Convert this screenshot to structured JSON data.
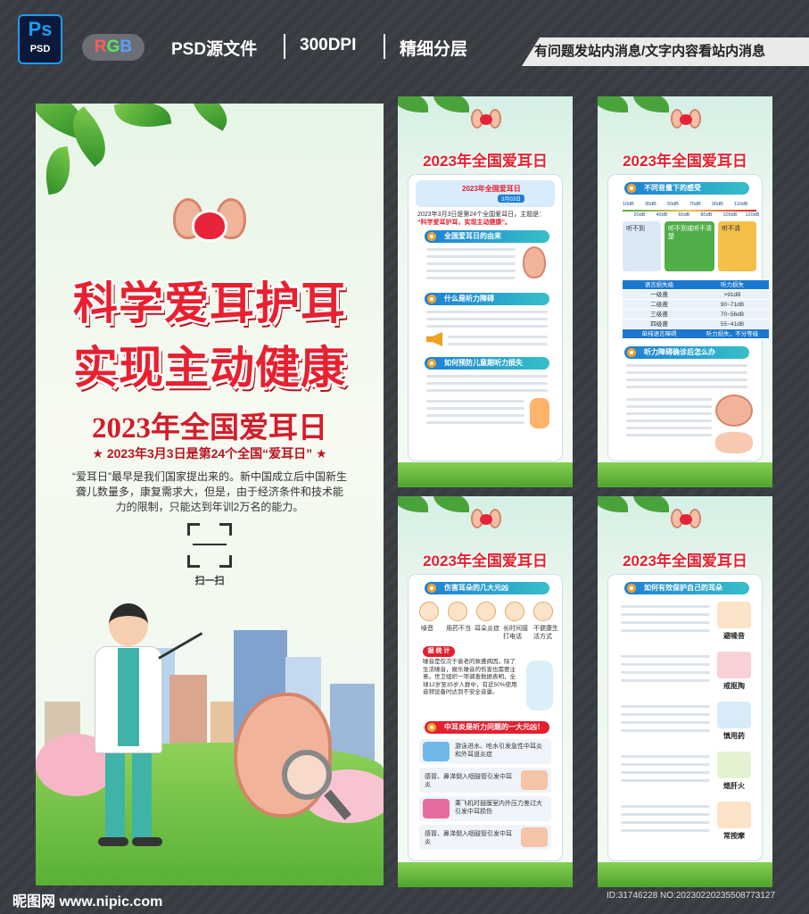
{
  "header": {
    "ps_logo": "Ps",
    "ps_sub": "PSD",
    "rgb_badge": [
      "R",
      "G",
      "B"
    ],
    "items": [
      "PSD源文件",
      "300DPI",
      "精细分层"
    ],
    "notice": "有问题发站内消息/文字内容看站内消息"
  },
  "main_poster": {
    "title_line1": "科学爱耳护耳",
    "title_line2": "实现主动健康",
    "subtitle": "2023年全国爱耳日",
    "tagline": "★ 2023年3月3日是第24个全国“爱耳日” ★",
    "body": "“爱耳日”最早是我们国家提出来的。新中国成立后中国新生聋儿数量多，康复需求大，但是，由于经济条件和技术能力的限制，只能达到年训2万名的能力。",
    "scan_label": "扫一扫"
  },
  "panels": [
    {
      "title": "2023年全国爱耳日",
      "banner": "2023年全国爱耳日",
      "banner_date": "3月03日",
      "intro": "2023年3月3日是第24个全国爱耳日，主题是：",
      "theme": "“科学爱耳护耳，实现主动健康”。",
      "sections": [
        "全国爱耳日的由来",
        "什么是听力障碍",
        "如何预防儿童期听力损失"
      ]
    },
    {
      "title": "2023年全国爱耳日",
      "sections": [
        "不同音量下的感受",
        "听力障碍确诊后怎么办"
      ],
      "db_scale": [
        "10dB",
        "20dB",
        "30dB",
        "40dB",
        "50dB",
        "60dB",
        "70dB",
        "80dB",
        "90dB",
        "100dB",
        "110dB",
        "120dB"
      ],
      "hear_labels": [
        "听不到",
        "听不到或听不清楚",
        "听不清"
      ],
      "table_header": [
        "语言损失级",
        "听力损失"
      ],
      "table_rows": [
        [
          "一级聋",
          ">91dB"
        ],
        [
          "二级聋",
          "90~71dB"
        ],
        [
          "三级聋",
          "70~56dB"
        ],
        [
          "四级聋",
          "55~41dB"
        ],
        [
          "单纯语言障碍",
          "听力损失，不分等级"
        ]
      ]
    },
    {
      "title": "2023年全国爱耳日",
      "sections": [
        "伤害耳朵的几大元凶",
        "中耳炎是听力问题的一大元凶！"
      ],
      "causes": [
        "噪音",
        "用药不当",
        "耳朵炎症",
        "长时间接打电话",
        "不健康生活方式"
      ],
      "stat_label": "据 统 计",
      "stat_text": "噪音是仅次于衰老的致聋病因。除了生活噪音，娱乐噪音的伤害也需要注意。世卫组织一项调查数据表明，全球12岁至35岁人群中，有近50%使用音频设备时达到不安全音量。",
      "otitis": [
        "游泳进水、呛水引发急性中耳炎和外耳道炎症",
        "感冒、鼻涕倒入咽鼓管引发中耳炎",
        "乘飞机时鼓膜室内外压力差过大引发中耳损伤",
        "感冒、鼻涕倒入咽鼓管引发中耳炎"
      ]
    },
    {
      "title": "2023年全国爱耳日",
      "sections": [
        "如何有效保护自己的耳朵"
      ],
      "tips": [
        "避噪音",
        "戒抠掏",
        "慎用药",
        "熄肝火",
        "常按摩"
      ]
    }
  ],
  "watermark": "昵图网 www.nipic.com",
  "image_id": "ID:31746228 NO:20230220235508773127"
}
